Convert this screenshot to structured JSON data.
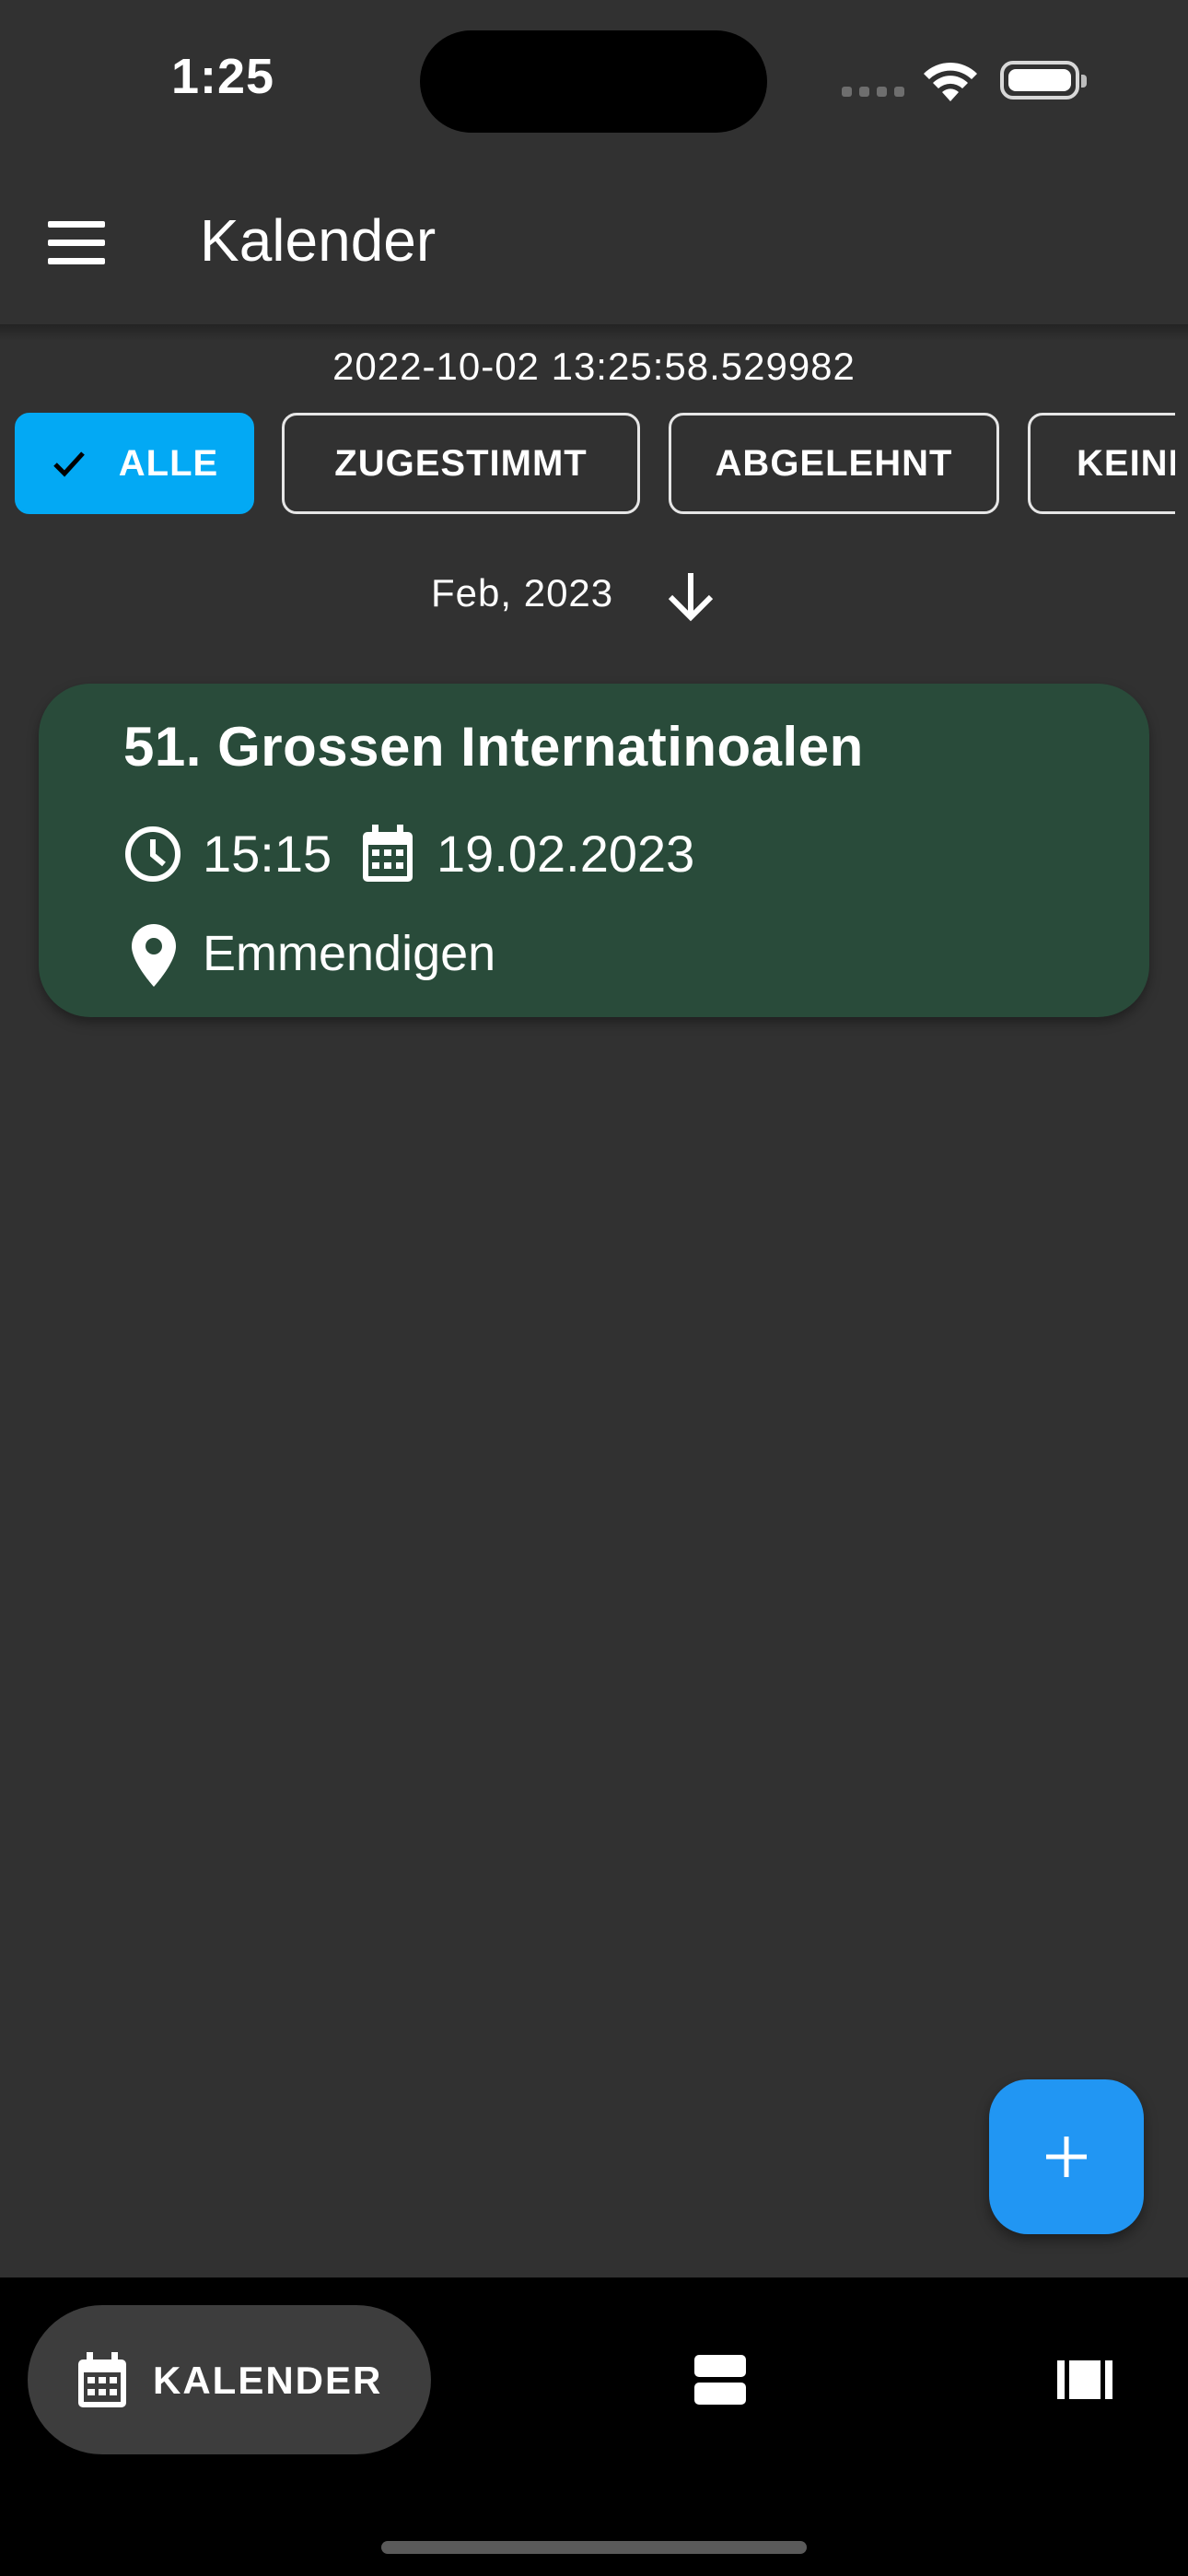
{
  "status_bar": {
    "time": "1:25"
  },
  "app_bar": {
    "title": "Kalender",
    "menu_icon": "menu-icon"
  },
  "timestamp": "2022-10-02 13:25:58.529982",
  "filters": [
    {
      "label": "ALLE",
      "selected": true
    },
    {
      "label": "ZUGESTIMMT",
      "selected": false
    },
    {
      "label": "ABGELEHNT",
      "selected": false
    },
    {
      "label": "KEINE",
      "selected": false
    }
  ],
  "month_header": {
    "label": "Feb, 2023",
    "icon": "arrow-down-icon"
  },
  "events": [
    {
      "title": "51. Grossen Internatinoalen",
      "time": "15:15",
      "date": "19.02.2023",
      "location": "Emmendigen"
    }
  ],
  "fab": {
    "icon": "plus-icon"
  },
  "bottom_nav": {
    "items": [
      {
        "label": "KALENDER",
        "icon": "calendar-icon",
        "active": true
      },
      {
        "label": "",
        "icon": "list-icon",
        "active": false
      },
      {
        "label": "",
        "icon": "columns-icon",
        "active": false
      }
    ]
  },
  "colors": {
    "background": "#313131",
    "chip_selected": "#03A9F4",
    "card": "#294B3A",
    "fab": "#2196F3",
    "nav_background": "#000000"
  }
}
